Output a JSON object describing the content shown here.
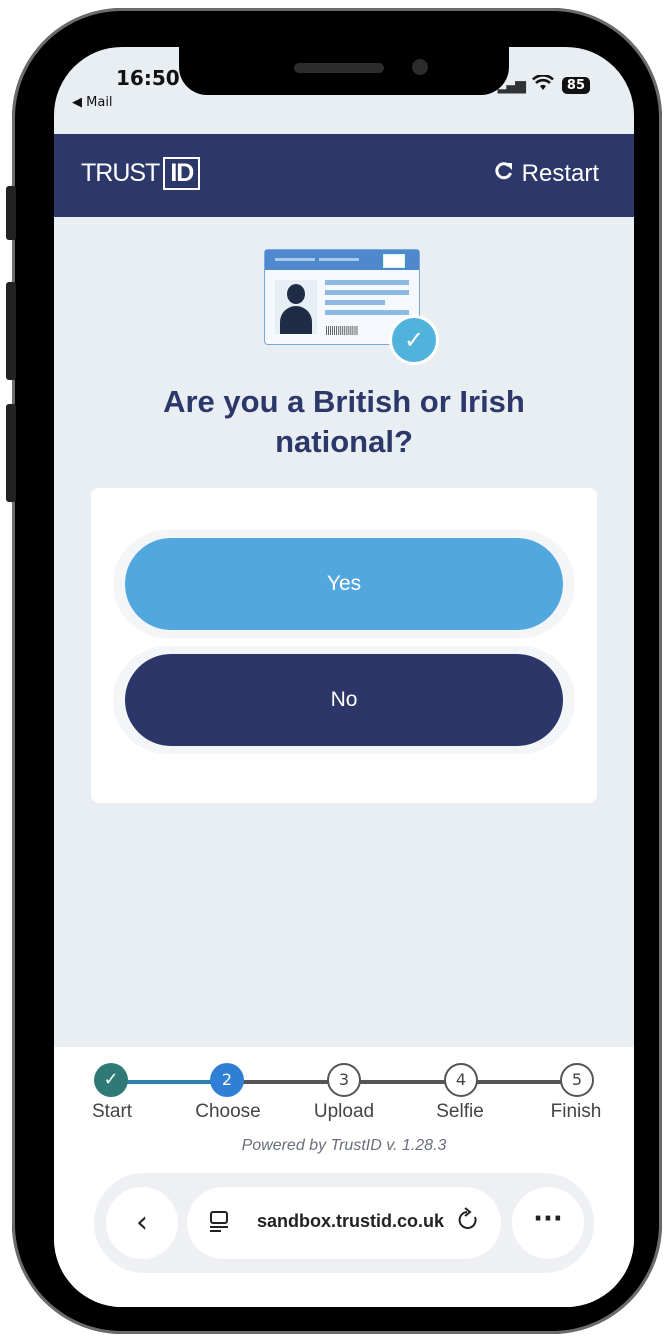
{
  "status_bar": {
    "time": "16:50",
    "back_app": "◀ Mail",
    "battery": "85"
  },
  "header": {
    "logo_text": "TRUST",
    "logo_id": "ID",
    "restart_label": "Restart"
  },
  "question": "Are you a British or Irish national?",
  "options": {
    "yes_label": "Yes",
    "no_label": "No"
  },
  "steps": [
    {
      "number": "✓",
      "label": "Start",
      "state": "done"
    },
    {
      "number": "2",
      "label": "Choose",
      "state": "active"
    },
    {
      "number": "3",
      "label": "Upload",
      "state": "todo"
    },
    {
      "number": "4",
      "label": "Selfie",
      "state": "todo"
    },
    {
      "number": "5",
      "label": "Finish",
      "state": "todo"
    }
  ],
  "powered_by": "Powered by TrustID v. 1.28.3",
  "browser": {
    "url": "sandbox.trustid.co.uk",
    "back_icon": "back-chevron-icon",
    "more_icon": "more-dots-icon"
  },
  "colors": {
    "brand_navy": "#2c376a",
    "accent_blue": "#52a7de",
    "active_step": "#2f7fd6",
    "done_step": "#2f7a76"
  }
}
